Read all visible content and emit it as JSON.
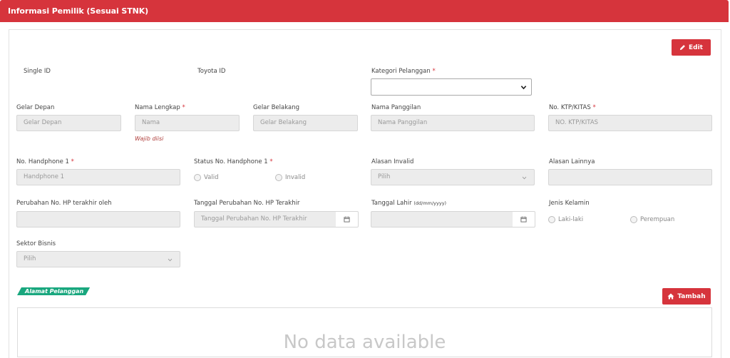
{
  "header": {
    "title": "Informasi Pemilik (Sesuai STNK)"
  },
  "buttons": {
    "edit": "Edit",
    "tambah": "Tambah"
  },
  "fields": {
    "single_id": {
      "label": "Single ID"
    },
    "toyota_id": {
      "label": "Toyota ID"
    },
    "kategori": {
      "label": "Kategori Pelanggan",
      "value": ""
    },
    "gelar_depan": {
      "label": "Gelar Depan",
      "placeholder": "Gelar Depan"
    },
    "nama_lengkap": {
      "label": "Nama Lengkap",
      "placeholder": "Nama",
      "error": "Wajib diisi"
    },
    "gelar_belakang": {
      "label": "Gelar Belakang",
      "placeholder": "Gelar Belakang"
    },
    "nama_panggilan": {
      "label": "Nama Panggilan",
      "placeholder": "Nama Panggilan"
    },
    "ktp": {
      "label": "No. KTP/KITAS",
      "placeholder": "NO. KTP/KITAS"
    },
    "handphone": {
      "label": "No. Handphone 1",
      "placeholder": "Handphone 1"
    },
    "status_hp": {
      "label": "Status No. Handphone 1",
      "options": [
        "Valid",
        "Invalid"
      ]
    },
    "alasan_invalid": {
      "label": "Alasan Invalid",
      "value": "Pilih"
    },
    "alasan_lainnya": {
      "label": "Alasan Lainnya"
    },
    "perubahan_oleh": {
      "label": "Perubahan No. HP terakhir oleh"
    },
    "tanggal_perubahan": {
      "label": "Tanggal Perubahan No. HP Terakhir",
      "placeholder": "Tanggal Perubahan No. HP Terakhir"
    },
    "tanggal_lahir": {
      "label": "Tanggal Lahir",
      "format": "(dd/mm/yyyy)"
    },
    "jenis_kelamin": {
      "label": "Jenis Kelamin",
      "options": [
        "Laki-laki",
        "Perempuan"
      ]
    },
    "sektor_bisnis": {
      "label": "Sektor Bisnis",
      "value": "Pilih"
    }
  },
  "required_mark": "*",
  "address": {
    "tag": "Alamat Pelanggan",
    "empty": "No data available"
  },
  "colors": {
    "primary": "#d6343c",
    "tag": "#19a77e"
  }
}
